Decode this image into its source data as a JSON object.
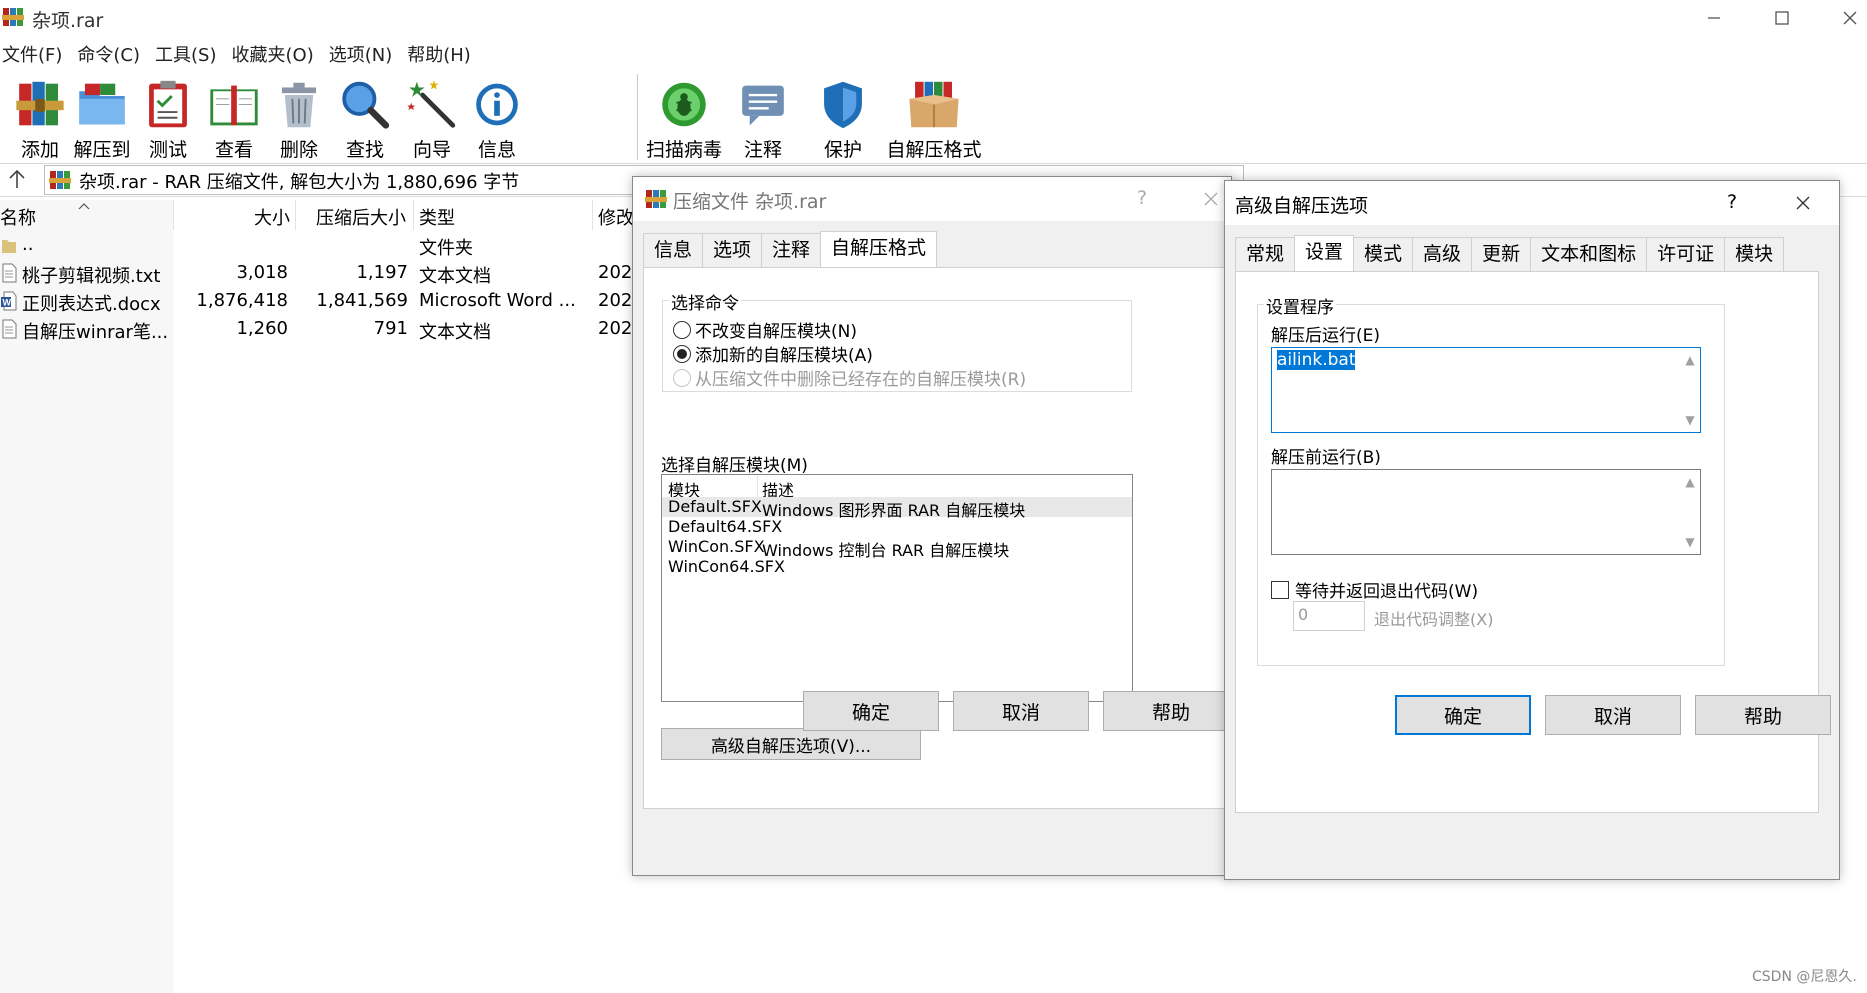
{
  "window": {
    "title": "杂项.rar",
    "menu": [
      "文件(F)",
      "命令(C)",
      "工具(S)",
      "收藏夹(O)",
      "选项(N)",
      "帮助(H)"
    ]
  },
  "toolbar": {
    "buttons": [
      {
        "label": "添加",
        "icon": "books-add-icon"
      },
      {
        "label": "解压到",
        "icon": "folder-extract-icon"
      },
      {
        "label": "测试",
        "icon": "clipboard-test-icon"
      },
      {
        "label": "查看",
        "icon": "open-book-icon"
      },
      {
        "label": "删除",
        "icon": "trash-icon"
      },
      {
        "label": "查找",
        "icon": "magnifier-icon"
      },
      {
        "label": "向导",
        "icon": "magic-wand-icon"
      },
      {
        "label": "信息",
        "icon": "info-icon"
      },
      {
        "label": "扫描病毒",
        "icon": "bug-scan-icon"
      },
      {
        "label": "注释",
        "icon": "comment-icon"
      },
      {
        "label": "保护",
        "icon": "shield-icon"
      },
      {
        "label": "自解压格式",
        "icon": "sfx-box-icon"
      }
    ]
  },
  "address": {
    "text": "杂项.rar - RAR 压缩文件, 解包大小为 1,880,696 字节"
  },
  "file_list": {
    "columns": [
      "名称",
      "大小",
      "压缩后大小",
      "类型",
      "修改"
    ],
    "rows": [
      {
        "name": "..",
        "size": "",
        "packed": "",
        "type": "文件夹",
        "modified": ""
      },
      {
        "name": "桃子剪辑视频.txt",
        "size": "3,018",
        "packed": "1,197",
        "type": "文本文档",
        "modified": "202"
      },
      {
        "name": "正则表达式.docx",
        "size": "1,876,418",
        "packed": "1,841,569",
        "type": "Microsoft Word ...",
        "modified": "202"
      },
      {
        "name": "自解压winrar笔...",
        "size": "1,260",
        "packed": "791",
        "type": "文本文档",
        "modified": "202"
      }
    ]
  },
  "compress_dialog": {
    "title": "压缩文件 杂项.rar",
    "help_glyph": "?",
    "tabs": [
      "信息",
      "选项",
      "注释",
      "自解压格式"
    ],
    "active_tab": "自解压格式",
    "group_label": "选择命令",
    "radios": [
      {
        "label": "不改变自解压模块(N)",
        "checked": false,
        "disabled": false
      },
      {
        "label": "添加新的自解压模块(A)",
        "checked": true,
        "disabled": false
      },
      {
        "label": "从压缩文件中删除已经存在的自解压模块(R)",
        "checked": false,
        "disabled": true
      }
    ],
    "module_label": "选择自解压模块(M)",
    "module_columns": [
      "模块",
      "描述"
    ],
    "modules": [
      {
        "name": "Default.SFX",
        "desc": "Windows 图形界面 RAR 自解压模块"
      },
      {
        "name": "Default64.SFX",
        "desc": ""
      },
      {
        "name": "WinCon.SFX",
        "desc": "Windows 控制台 RAR 自解压模块"
      },
      {
        "name": "WinCon64.SFX",
        "desc": ""
      }
    ],
    "advanced_button": "高级自解压选项(V)...",
    "ok": "确定",
    "cancel": "取消",
    "help": "帮助"
  },
  "advanced_dialog": {
    "title": "高级自解压选项",
    "help_glyph": "?",
    "tabs": [
      "常规",
      "设置",
      "模式",
      "高级",
      "更新",
      "文本和图标",
      "许可证",
      "模块"
    ],
    "active_tab": "设置",
    "group_label": "设置程序",
    "run_after_label": "解压后运行(E)",
    "run_after_value": "ailink.bat",
    "run_before_label": "解压前运行(B)",
    "run_before_value": "",
    "wait_label": "等待并返回退出代码(W)",
    "wait_checked": false,
    "exit_code_value": "0",
    "exit_code_label": "退出代码调整(X)",
    "ok": "确定",
    "cancel": "取消",
    "help": "帮助"
  },
  "watermark": "CSDN @尼恩久.",
  "colors": {
    "selection": "#0078d7",
    "dialog_bg": "#f0f0f0",
    "default_button_border": "#0078d7"
  }
}
